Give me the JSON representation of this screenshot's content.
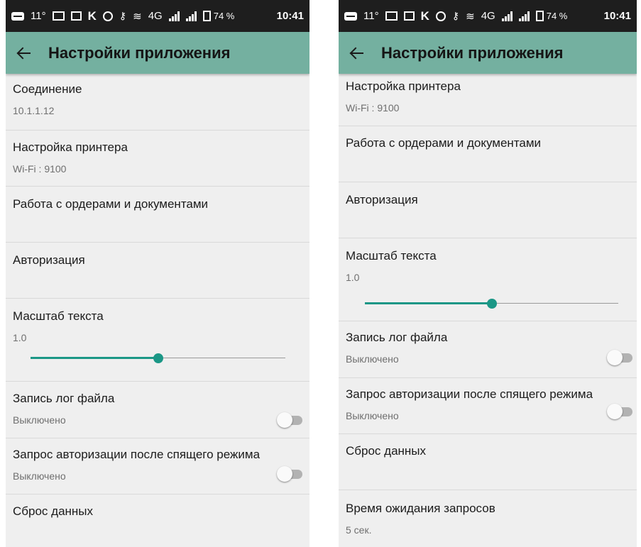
{
  "status_bar": {
    "temperature": "11°",
    "k_label": "K",
    "network": "4G",
    "battery": "74 %",
    "time": "10:41",
    "icons": [
      "message-icon",
      "mail-icon",
      "image-icon",
      "alarm-icon",
      "vpn-key-icon",
      "wifi-icon",
      "signal-icon",
      "battery-icon"
    ]
  },
  "toolbar": {
    "title": "Настройки приложения",
    "back_icon": "arrow-left-icon",
    "color": "#74b0a0"
  },
  "settings": {
    "connection": {
      "title": "Соединение",
      "value": "10.1.1.12"
    },
    "printer": {
      "title": "Настройка принтера",
      "value": "Wi-Fi  : 9100"
    },
    "orders": {
      "title": "Работа с ордерами и документами"
    },
    "auth": {
      "title": "Авторизация"
    },
    "text_scale": {
      "title": "Масштаб текста",
      "value": "1.0",
      "slider_fraction": 0.5
    },
    "log_file": {
      "title": "Запись лог файла",
      "value": "Выключено",
      "enabled": false
    },
    "auth_sleep": {
      "title": "Запрос авторизации после спящего режима",
      "value": "Выключено",
      "enabled": false
    },
    "reset": {
      "title": "Сброс данных"
    },
    "timeout": {
      "title": "Время ожидания запросов",
      "value": "5 сек."
    }
  },
  "colors": {
    "accent": "#1b9786",
    "status_bar": "#1e1e1e",
    "background": "#efefef"
  }
}
